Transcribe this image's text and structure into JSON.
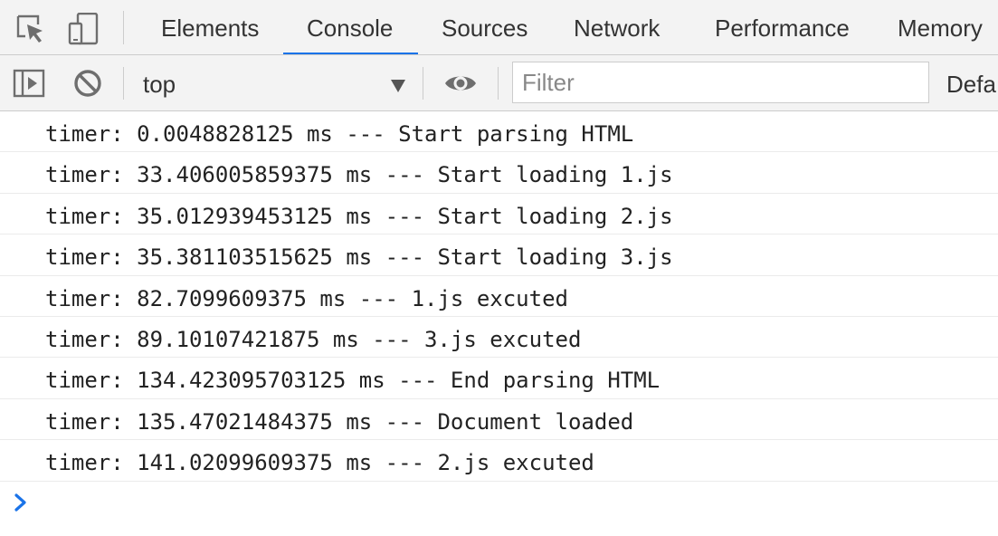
{
  "tabbar": {
    "icons": [
      "inspect-element-icon",
      "device-toolbar-icon"
    ],
    "tabs": [
      {
        "label": "Elements"
      },
      {
        "label": "Console"
      },
      {
        "label": "Sources"
      },
      {
        "label": "Network"
      },
      {
        "label": "Performance"
      },
      {
        "label": "Memory"
      }
    ],
    "active_tab": "Console",
    "accent_color": "#1a73e8"
  },
  "toolbar": {
    "icons": [
      "show-sidebar-icon",
      "clear-console-icon",
      "live-expression-eye-icon"
    ],
    "context_value": "top",
    "filter_placeholder": "Filter",
    "filter_value": "",
    "levels_label": "Defa"
  },
  "messages": [
    {
      "text": "timer: 0.0048828125 ms --- Start parsing HTML"
    },
    {
      "text": "timer: 33.406005859375 ms --- Start loading 1.js"
    },
    {
      "text": "timer: 35.012939453125 ms --- Start loading 2.js"
    },
    {
      "text": "timer: 35.381103515625 ms --- Start loading 3.js"
    },
    {
      "text": "timer: 82.7099609375 ms --- 1.js excuted"
    },
    {
      "text": "timer: 89.10107421875 ms --- 3.js excuted"
    },
    {
      "text": "timer: 134.423095703125 ms --- End parsing HTML"
    },
    {
      "text": "timer: 135.47021484375 ms --- Document loaded"
    },
    {
      "text": "timer: 141.02099609375 ms --- 2.js excuted"
    }
  ],
  "prompt_icon": "chevron-right-icon",
  "prompt_color": "#1a73e8"
}
